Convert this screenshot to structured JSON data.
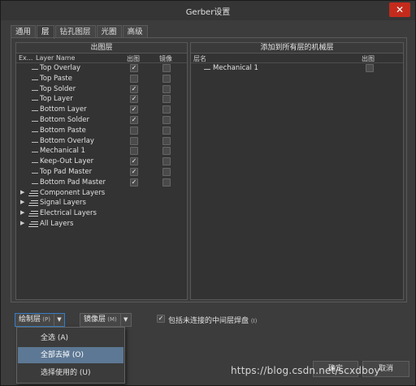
{
  "window": {
    "title": "Gerber设置",
    "close_icon": "✕"
  },
  "tabs": [
    {
      "label": "通用",
      "active": false
    },
    {
      "label": "层",
      "active": true
    },
    {
      "label": "钻孔图层",
      "active": false
    },
    {
      "label": "光圈",
      "active": false
    },
    {
      "label": "高级",
      "active": false
    }
  ],
  "left_panel": {
    "header": "出图层",
    "columns": {
      "expand": "Ex...",
      "name": "Layer Name",
      "plot": "出图",
      "mirror": "镜像"
    },
    "rows": [
      {
        "name": "Top Overlay",
        "plot": true,
        "mirror": false
      },
      {
        "name": "Top Paste",
        "plot": false,
        "mirror": false
      },
      {
        "name": "Top Solder",
        "plot": true,
        "mirror": false
      },
      {
        "name": "Top Layer",
        "plot": true,
        "mirror": false
      },
      {
        "name": "Bottom Layer",
        "plot": true,
        "mirror": false
      },
      {
        "name": "Bottom Solder",
        "plot": true,
        "mirror": false
      },
      {
        "name": "Bottom Paste",
        "plot": false,
        "mirror": false
      },
      {
        "name": "Bottom Overlay",
        "plot": false,
        "mirror": false
      },
      {
        "name": "Mechanical 1",
        "plot": false,
        "mirror": false
      },
      {
        "name": "Keep-Out Layer",
        "plot": true,
        "mirror": false
      },
      {
        "name": "Top Pad Master",
        "plot": true,
        "mirror": false
      },
      {
        "name": "Bottom Pad Master",
        "plot": true,
        "mirror": false
      }
    ],
    "groups": [
      {
        "name": "Component Layers"
      },
      {
        "name": "Signal Layers"
      },
      {
        "name": "Electrical Layers"
      },
      {
        "name": "All Layers"
      }
    ]
  },
  "right_panel": {
    "header": "添加到所有层的机械层",
    "columns": {
      "name": "层名",
      "plot": "出图"
    },
    "rows": [
      {
        "name": "Mechanical 1",
        "plot": false
      }
    ]
  },
  "controls": {
    "draw_layers": {
      "label": "绘制层",
      "key": "P"
    },
    "mirror_layers": {
      "label": "镜像层",
      "key": "M"
    },
    "include_unconnected": {
      "label": "包括未连接的中间层焊盘",
      "key": "I",
      "checked": true
    }
  },
  "dropdown_menu": [
    {
      "label": "全选 (A)",
      "active": false
    },
    {
      "label": "全部去掉 (O)",
      "active": true
    },
    {
      "label": "选择使用的 (U)",
      "active": false
    }
  ],
  "footer": {
    "ok": "确定",
    "cancel": "取消"
  },
  "watermark": "https://blog.csdn.net/scxdboy",
  "colors": {
    "window_bg": "#3c3c3c",
    "close": "#c42b1c",
    "menu_highlight": "#5d7894",
    "focus_border": "#3a7dc4"
  }
}
